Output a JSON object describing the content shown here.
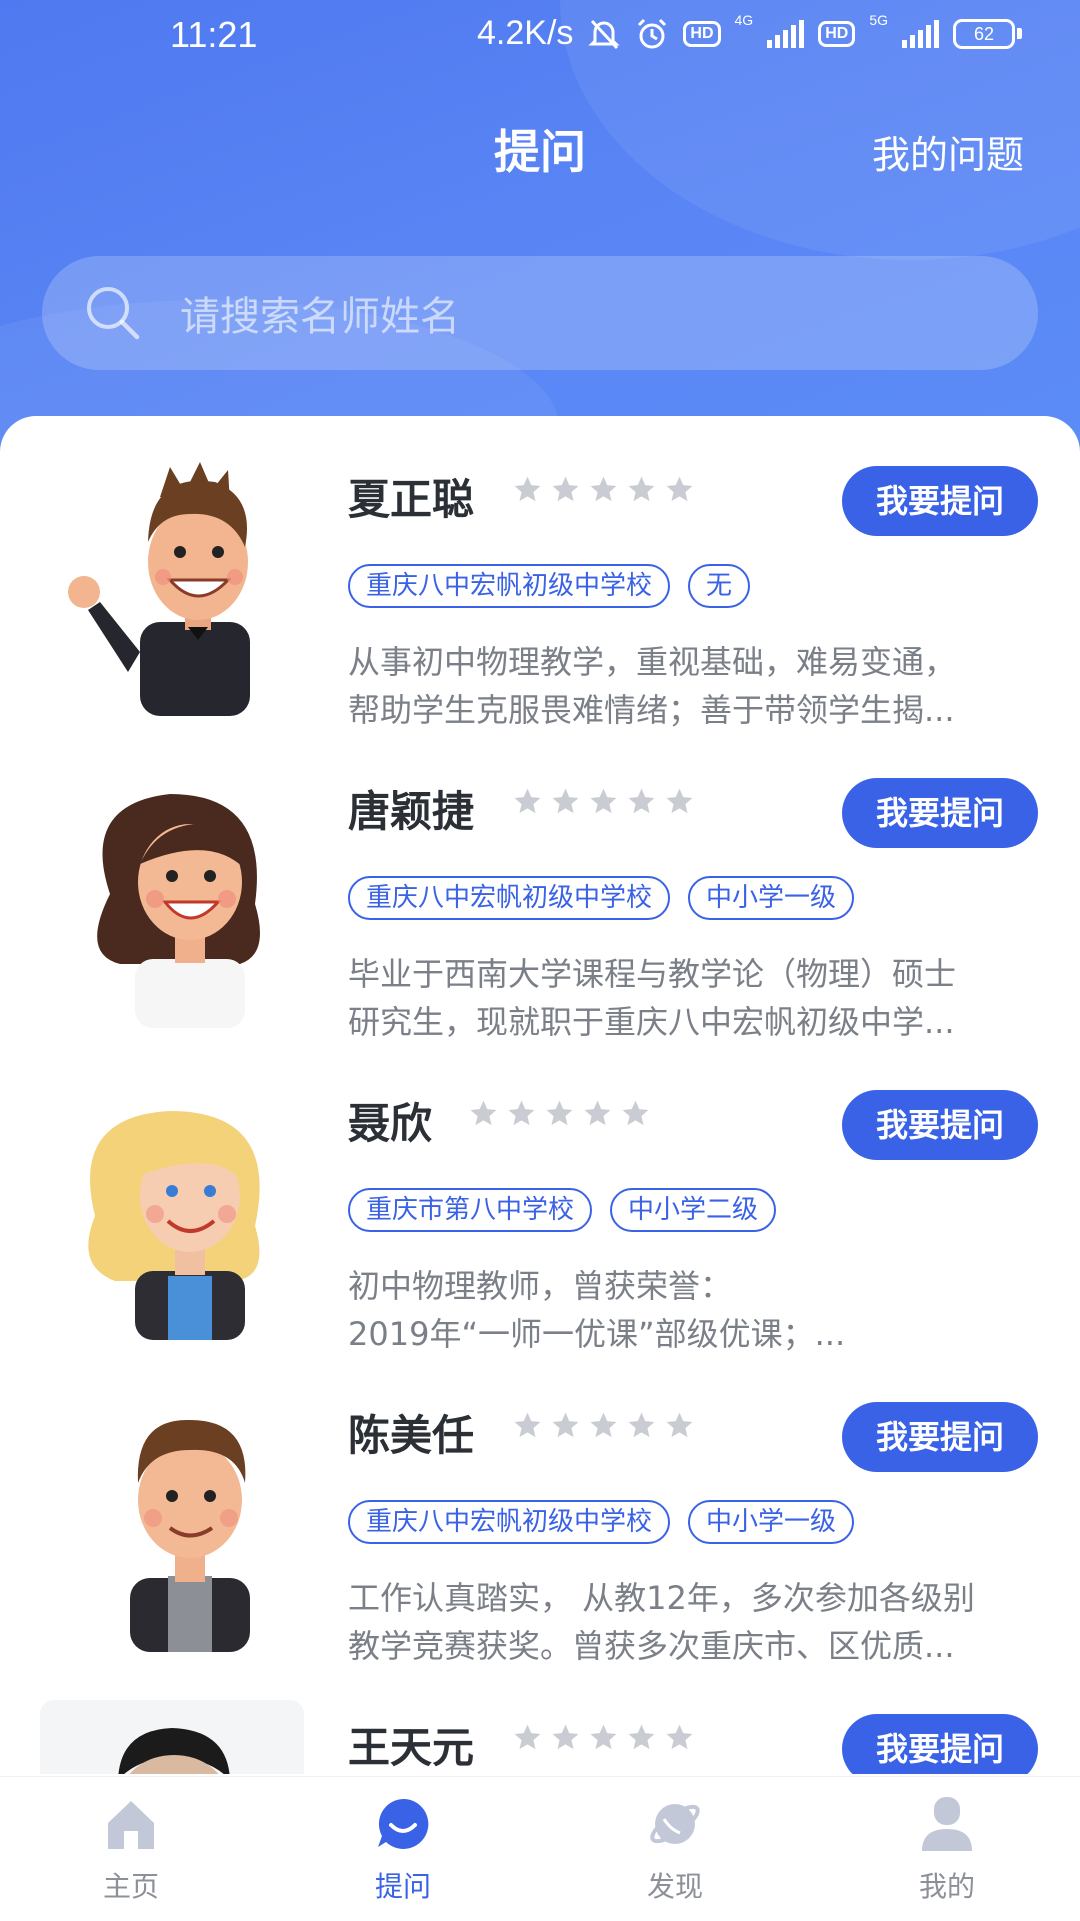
{
  "status_bar": {
    "time": "11:21",
    "net_speed": "4.2K/s",
    "hd1": "HD",
    "net1": "4G",
    "hd2": "HD",
    "net2": "5G",
    "battery": "62"
  },
  "header": {
    "title": "提问",
    "my_questions": "我的问题"
  },
  "search": {
    "placeholder": "请搜索名师姓名"
  },
  "teachers": [
    {
      "name": "夏正聪",
      "rating": 0,
      "tags": [
        "重庆八中宏帆初级中学校",
        "无"
      ],
      "desc_line1": "从事初中物理教学，重视基础，难易变通，",
      "desc_line2": "帮助学生克服畏难情绪；善于带领学生揭...",
      "button": "我要提问",
      "avatar": "male-teacher-waving-avatar"
    },
    {
      "name": "唐颖捷",
      "rating": 0,
      "tags": [
        "重庆八中宏帆初级中学校",
        "中小学一级"
      ],
      "desc_line1": "毕业于西南大学课程与教学论（物理）硕士",
      "desc_line2": "研究生，现就职于重庆八中宏帆初级中学...",
      "button": "我要提问",
      "avatar": "female-brown-hair-avatar"
    },
    {
      "name": "聂欣",
      "rating": 0,
      "tags": [
        "重庆市第八中学校",
        "中小学二级"
      ],
      "desc_line1": "初中物理教师，曾获荣誉：",
      "desc_line2": "2019年“一师一优课”部级优课；...",
      "button": "我要提问",
      "avatar": "female-blonde-avatar"
    },
    {
      "name": "陈美任",
      "rating": 0,
      "tags": [
        "重庆八中宏帆初级中学校",
        "中小学一级"
      ],
      "desc_line1": "工作认真踏实， 从教12年，多次参加各级别",
      "desc_line2": "教学竞赛获奖。曾获多次重庆市、区优质...",
      "button": "我要提问",
      "avatar": "male-brown-hair-avatar"
    },
    {
      "name": "王天元",
      "rating": 0,
      "tags": [],
      "desc_line1": "",
      "desc_line2": "",
      "button": "我要提问",
      "avatar": "teacher-photo-avatar"
    }
  ],
  "tabbar": [
    {
      "label": "主页",
      "icon": "home-icon",
      "active": false
    },
    {
      "label": "提问",
      "icon": "chat-bubble-icon",
      "active": true
    },
    {
      "label": "发现",
      "icon": "planet-icon",
      "active": false
    },
    {
      "label": "我的",
      "icon": "user-icon",
      "active": false
    }
  ],
  "colors": {
    "primary": "#3a62e6",
    "header_gradient_start": "#4f79f0",
    "header_gradient_end": "#5b8cf7",
    "star_gray": "#c9ccd2",
    "tab_inactive": "#c3c8d8"
  }
}
